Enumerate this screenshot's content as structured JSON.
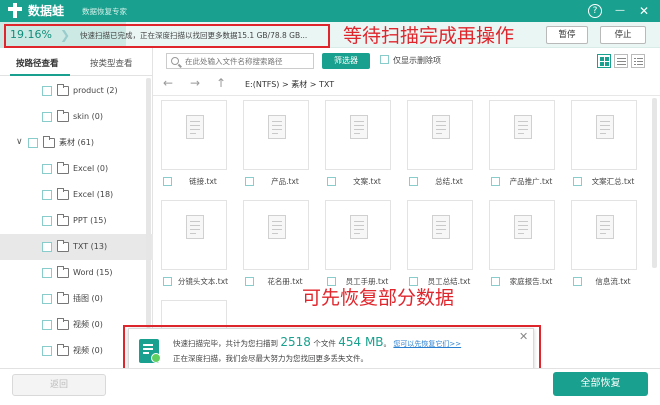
{
  "app": {
    "name": "数据蛙",
    "subtitle": "数据恢复专家"
  },
  "colors": {
    "brand": "#1aa08e",
    "annotation": "#e0262d",
    "link": "#2a7fd0"
  },
  "progress": {
    "percent_label": "19.16%",
    "fraction": 0.1916,
    "status_text": "快速扫描已完成，正在深度扫描以找回更多数据15.1 GB/78.8 GB...",
    "pause_label": "暂停",
    "stop_label": "停止"
  },
  "annotations": {
    "wait": "等待扫描完成再操作",
    "recover_partial": "可先恢复部分数据"
  },
  "sidebar": {
    "tabs": [
      "按路径查看",
      "按类型查看"
    ],
    "items": [
      {
        "label": "product (2)"
      },
      {
        "label": "skin (0)"
      },
      {
        "label": "素材 (61)"
      },
      {
        "label": "Excel (0)"
      },
      {
        "label": "Excel (18)"
      },
      {
        "label": "PPT (15)"
      },
      {
        "label": "TXT (13)"
      },
      {
        "label": "Word (15)"
      },
      {
        "label": "插图 (0)"
      },
      {
        "label": "视频 (0)"
      },
      {
        "label": "视频 (0)"
      }
    ]
  },
  "toolbar": {
    "search_placeholder": "在此处输入文件名称搜索路径",
    "filter_label": "筛选器",
    "show_deleted_label": "仅显示删除项"
  },
  "path": {
    "text": "E:(NTFS) > 素材 > TXT"
  },
  "files": [
    {
      "name": "链接.txt"
    },
    {
      "name": "产品.txt"
    },
    {
      "name": "文案.txt"
    },
    {
      "name": "总结.txt"
    },
    {
      "name": "产品推广.txt"
    },
    {
      "name": "文案汇总.txt"
    },
    {
      "name": "分镜头文本.txt"
    },
    {
      "name": "花名册.txt"
    },
    {
      "name": "员工手册.txt"
    },
    {
      "name": "员工总结.txt"
    },
    {
      "name": "家庭报告.txt"
    },
    {
      "name": "信息流.txt"
    }
  ],
  "toast": {
    "prefix": "快速扫描完毕，共计为您扫描到",
    "count": "2518",
    "mid": "个文件",
    "size": "454 MB",
    "period": "。",
    "link": "您可以先恢复它们>>",
    "line2": "正在深度扫描，我们会尽最大努力为您找回更多丢失文件。"
  },
  "footer": {
    "back_label": "返回",
    "recover_all_label": "全部恢复"
  }
}
